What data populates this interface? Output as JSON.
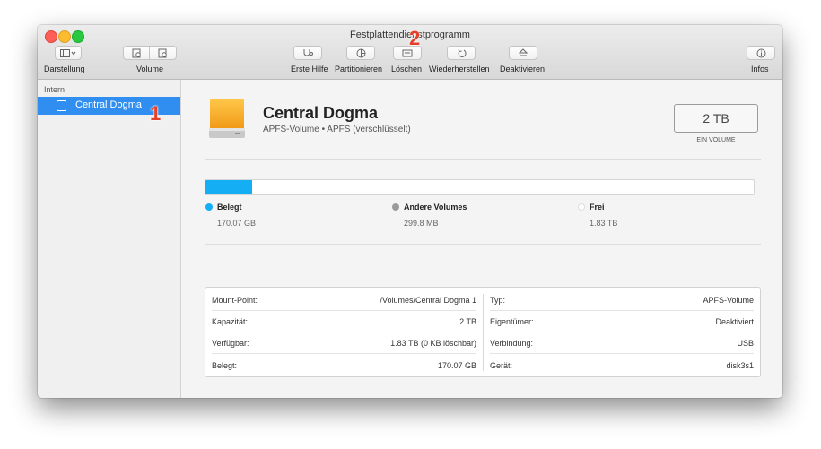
{
  "window": {
    "title": "Festplattendienstprogramm"
  },
  "toolbar": {
    "view_label": "Darstellung",
    "volume_label": "Volume",
    "first_aid_label": "Erste Hilfe",
    "partition_label": "Partitionieren",
    "erase_label": "Löschen",
    "restore_label": "Wiederherstellen",
    "unmount_label": "Deaktivieren",
    "info_label": "Infos"
  },
  "sidebar": {
    "heading": "Intern",
    "items": [
      {
        "label": "Central Dogma",
        "selected": true
      }
    ]
  },
  "volume": {
    "name": "Central Dogma",
    "subtitle": "APFS-Volume • APFS (verschlüsselt)",
    "capacity": "2 TB",
    "capacity_caption": "EIN VOLUME"
  },
  "usage": {
    "used_fraction": 0.085,
    "legend": [
      {
        "label": "Belegt",
        "value": "170.07 GB",
        "color": "#14aef5"
      },
      {
        "label": "Andere Volumes",
        "value": "299.8 MB",
        "color": "#9b9b9b"
      },
      {
        "label": "Frei",
        "value": "1.83 TB",
        "color": "#ffffff"
      }
    ]
  },
  "info_table": {
    "left": [
      {
        "key": "Mount-Point:",
        "value": "/Volumes/Central Dogma 1"
      },
      {
        "key": "Kapazität:",
        "value": "2 TB"
      },
      {
        "key": "Verfügbar:",
        "value": "1.83 TB (0 KB löschbar)"
      },
      {
        "key": "Belegt:",
        "value": "170.07 GB"
      }
    ],
    "right": [
      {
        "key": "Typ:",
        "value": "APFS-Volume"
      },
      {
        "key": "Eigentümer:",
        "value": "Deaktiviert"
      },
      {
        "key": "Verbindung:",
        "value": "USB"
      },
      {
        "key": "Gerät:",
        "value": "disk3s1"
      }
    ]
  },
  "annotations": {
    "marker_1": "1",
    "marker_2": "2"
  },
  "colors": {
    "selection": "#2f8ef0",
    "used": "#14aef5",
    "marker": "#e4402a"
  }
}
